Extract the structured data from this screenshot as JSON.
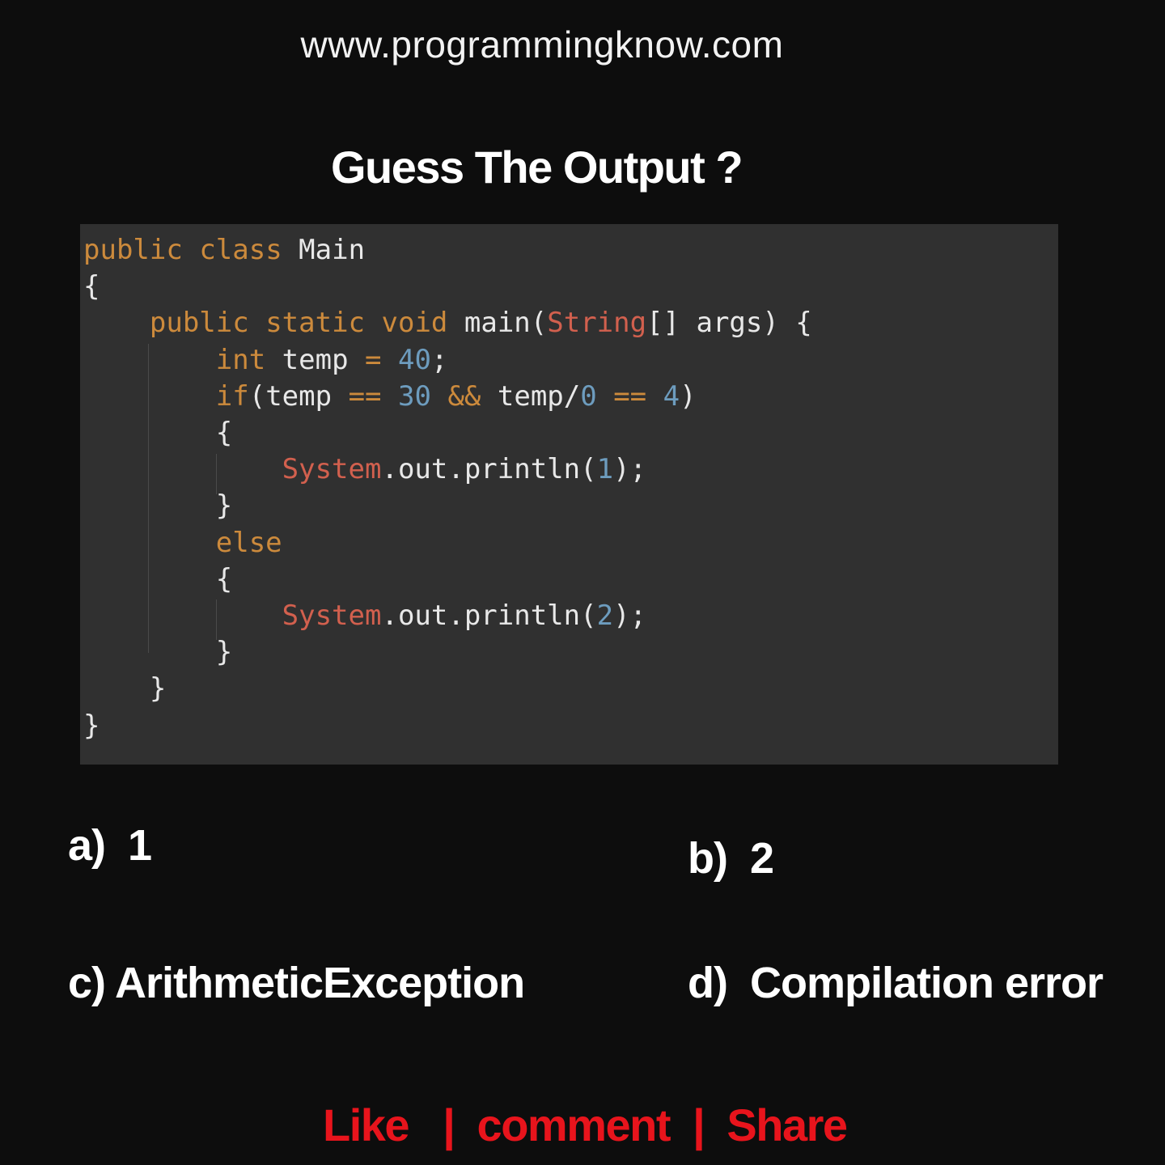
{
  "header": {
    "site_url": "www.programmingknow.com",
    "title": "Guess The Output ?"
  },
  "code": {
    "language": "java",
    "lines": [
      "public class Main",
      "{",
      "    public static void main(String[] args) {",
      "        int temp = 40;",
      "        if(temp == 30 && temp/0 == 4)",
      "        {",
      "            System.out.println(1);",
      "        }",
      "        else",
      "        {",
      "            System.out.println(2);",
      "        }",
      "    }",
      "}"
    ],
    "colors": {
      "background": "#303030",
      "keyword": "#cc8a3c",
      "class_name": "#d2604e",
      "number": "#6d9cbe",
      "text": "#e8e8e8"
    }
  },
  "options": {
    "a": {
      "label": "a)",
      "text": "1"
    },
    "b": {
      "label": "b)",
      "text": "2"
    },
    "c": {
      "label": "c)",
      "text": "ArithmeticException"
    },
    "d": {
      "label": "d)",
      "text": "Compilation error"
    }
  },
  "footer": {
    "like": "Like",
    "separator": "|",
    "comment": "comment",
    "share": "Share",
    "color": "#e8141c"
  }
}
